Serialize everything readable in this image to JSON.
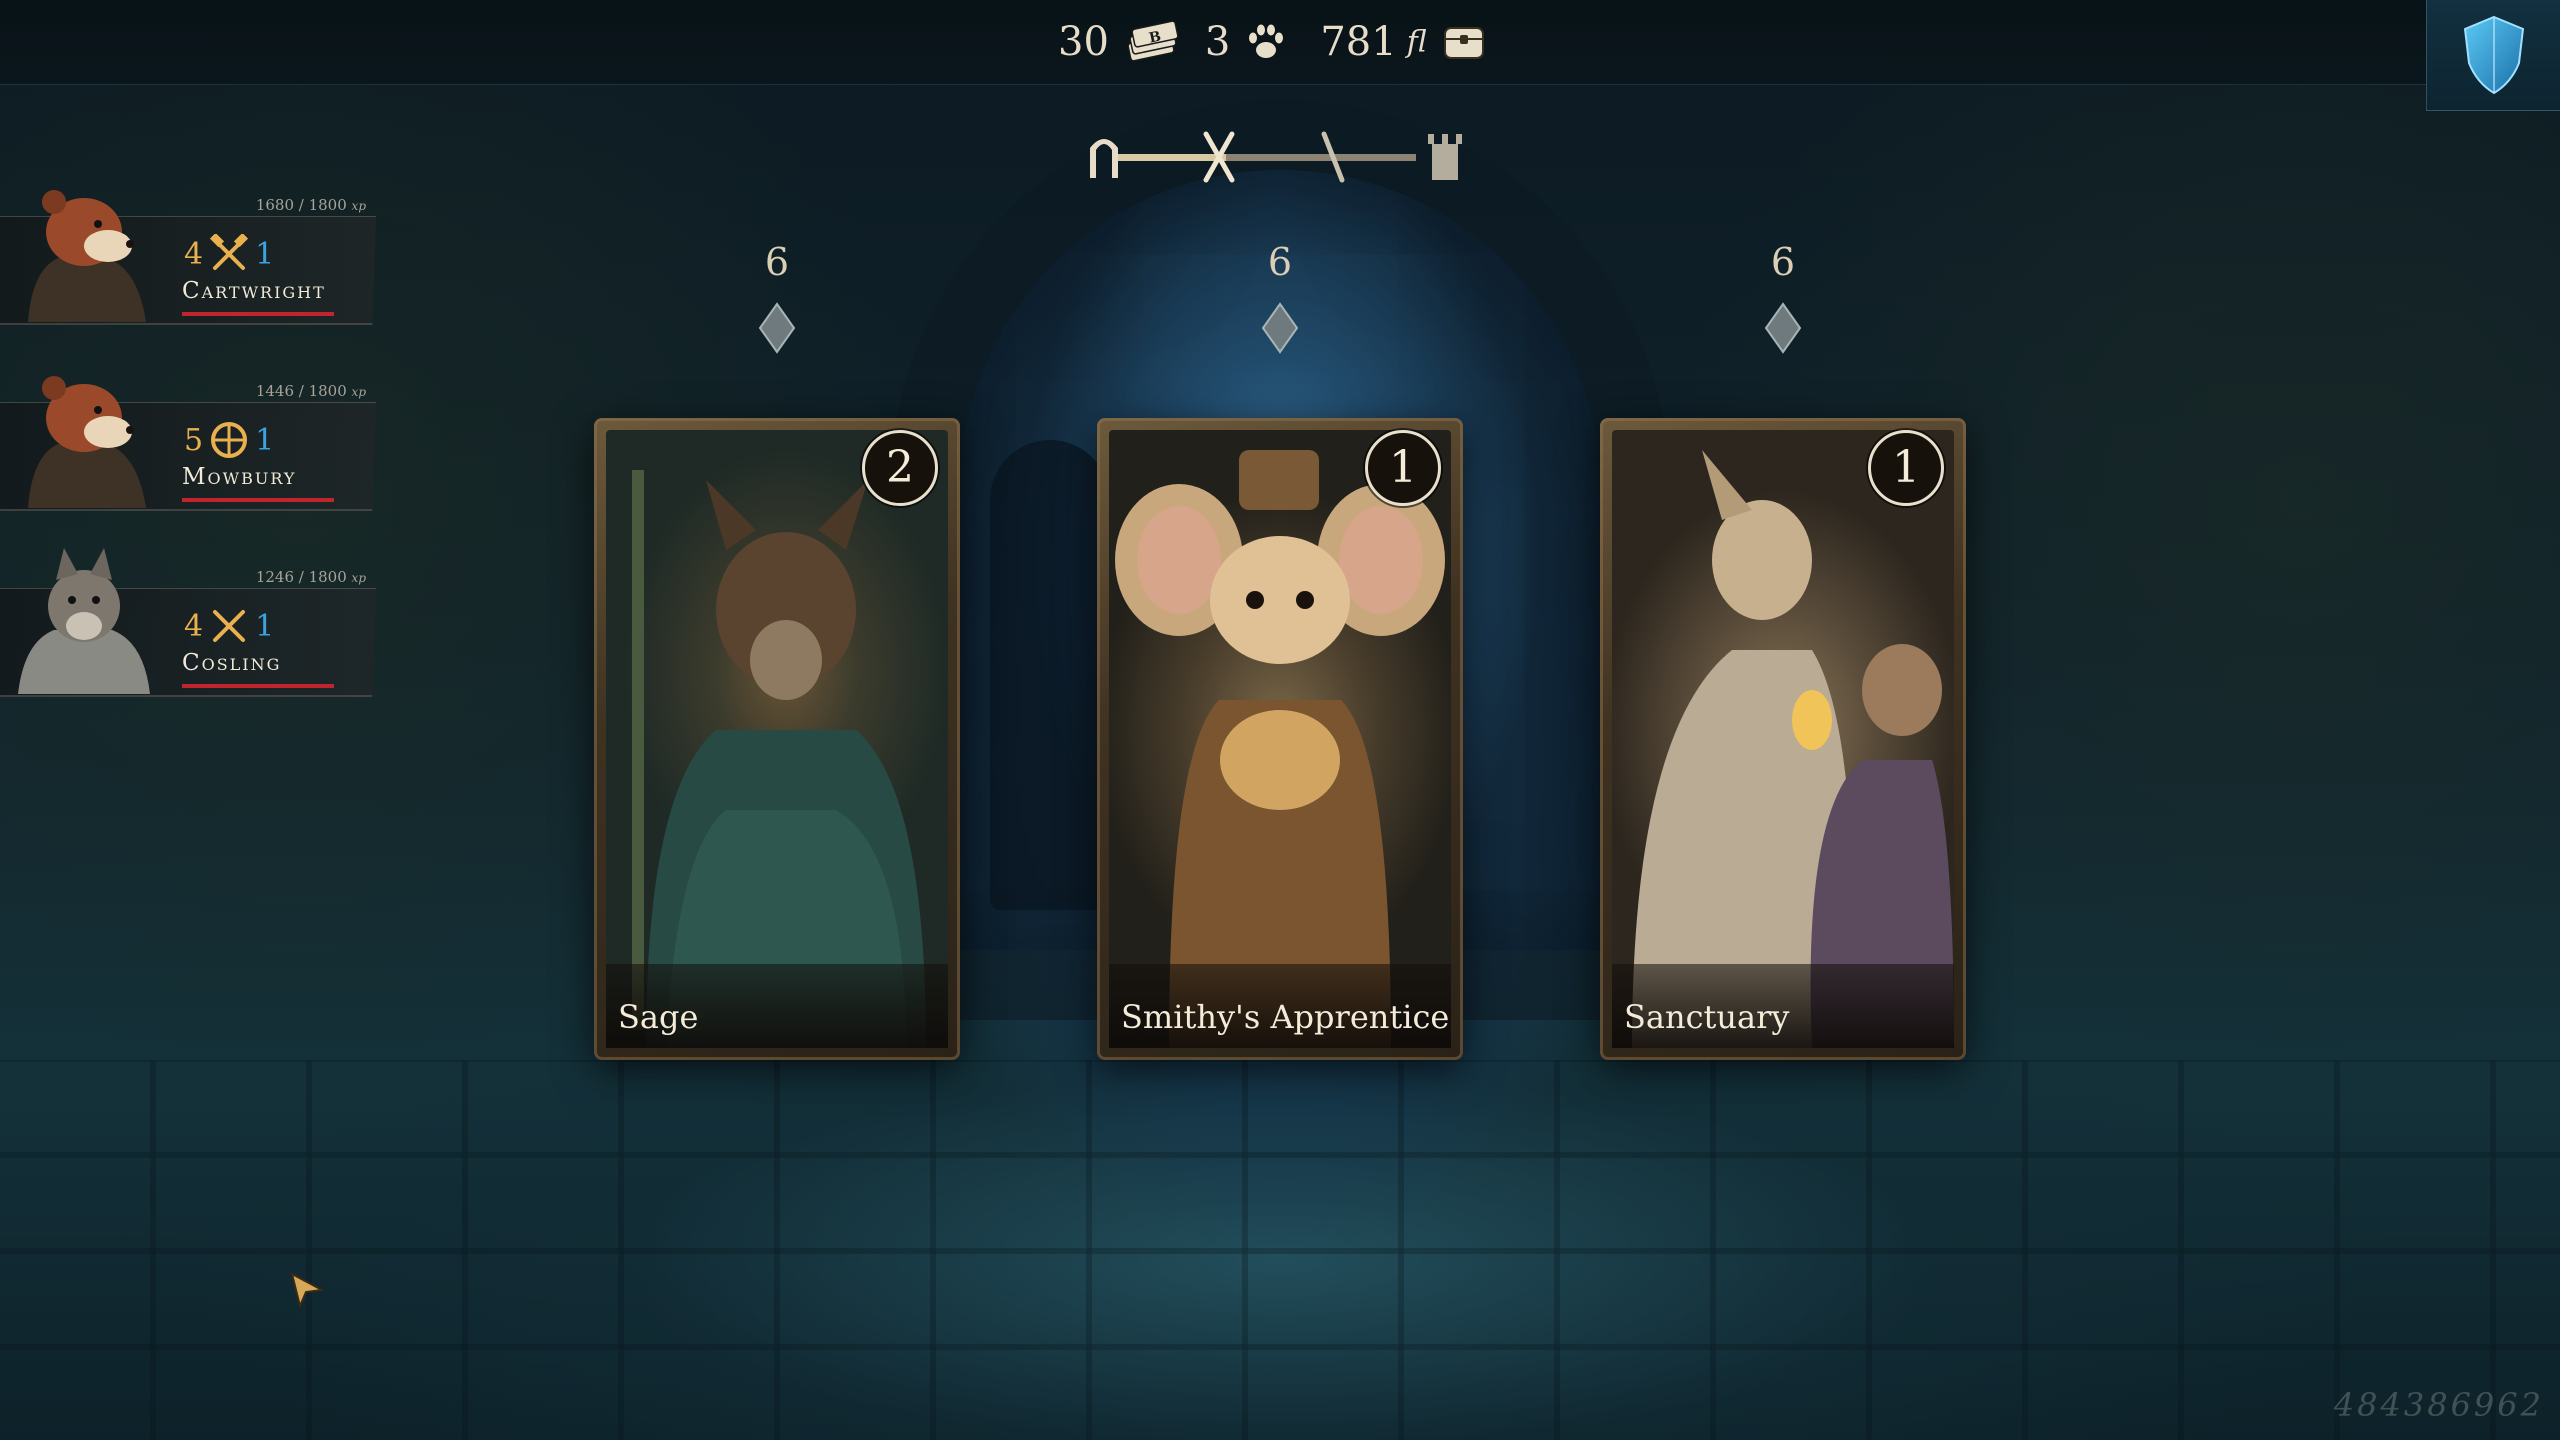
{
  "resources": {
    "cards": "30",
    "paws": "3",
    "gold": "781",
    "gold_unit": "fl"
  },
  "party": [
    {
      "name": "Cartwright",
      "xp": "1680 / 1800",
      "xp_unit": "xp",
      "attack": "4",
      "defense": "1",
      "hp_fraction": 1.0
    },
    {
      "name": "Mowbury",
      "xp": "1446 / 1800",
      "xp_unit": "xp",
      "attack": "5",
      "defense": "1",
      "hp_fraction": 1.0
    },
    {
      "name": "Cosling",
      "xp": "1246 / 1800",
      "xp_unit": "xp",
      "attack": "4",
      "defense": "1",
      "hp_fraction": 1.0
    }
  ],
  "cards": [
    {
      "title": "Sage",
      "cost": "6",
      "count": "2"
    },
    {
      "title": "Smithy's Apprentice",
      "cost": "6",
      "count": "1"
    },
    {
      "title": "Sanctuary",
      "cost": "6",
      "count": "1"
    }
  ],
  "seed": "484386962",
  "colors": {
    "attack": "#e9b04f",
    "defense": "#3aa3e0",
    "hp": "#c0242c",
    "text": "#f1ead8"
  }
}
